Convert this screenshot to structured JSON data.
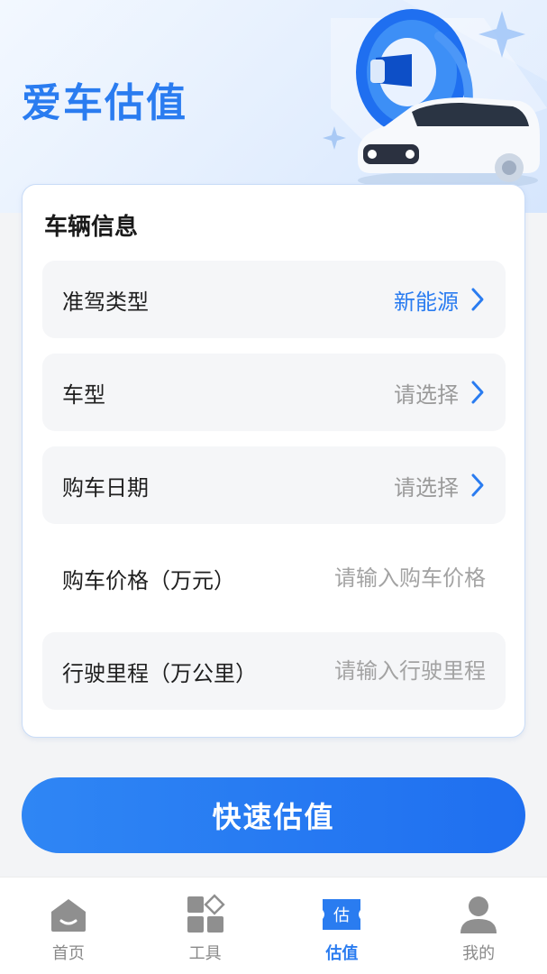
{
  "header": {
    "title": "爱车估值"
  },
  "vehicle_info": {
    "title": "车辆信息",
    "rows": [
      {
        "label": "准驾类型",
        "value": "新能源",
        "active": true
      },
      {
        "label": "车型",
        "value": "请选择"
      },
      {
        "label": "购车日期",
        "value": "请选择"
      }
    ],
    "price": {
      "label": "购车价格（万元）",
      "placeholder": "请输入购车价格",
      "value": ""
    },
    "mileage": {
      "label": "行驶里程（万公里）",
      "placeholder": "请输入行驶里程",
      "value": ""
    }
  },
  "cta": {
    "label": "快速估值"
  },
  "tabbar": {
    "items": [
      {
        "label": "首页",
        "icon": "home-icon"
      },
      {
        "label": "工具",
        "icon": "tools-icon"
      },
      {
        "label": "估值",
        "icon": "valuation-icon",
        "badge": "估",
        "active": true
      },
      {
        "label": "我的",
        "icon": "profile-icon"
      }
    ]
  },
  "colors": {
    "accent": "#2a7cf0",
    "inactive": "#8a8a8a",
    "placeholder": "#9a9a9a"
  }
}
